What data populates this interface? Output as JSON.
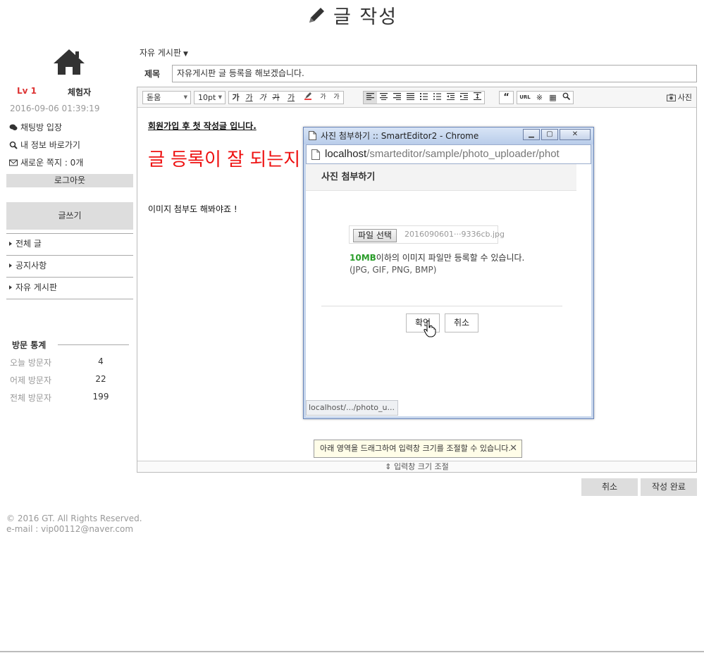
{
  "page": {
    "title": "글 작성"
  },
  "sidebar": {
    "level": "Lv 1",
    "rank": "체험자",
    "last_login": "2016-09-06 01:39:19",
    "chat_link": "채팅방 입장",
    "profile_link": "내 정보 바로가기",
    "messages_link": "새로운 쪽지 : 0개",
    "logout": "로그아웃",
    "write": "글쓰기",
    "menu": [
      {
        "label": "전체 글"
      },
      {
        "label": "공지사항"
      },
      {
        "label": "자유 게시판"
      }
    ],
    "stats": {
      "title": "방문 통계",
      "rows": [
        {
          "label": "오늘 방문자",
          "value": "4"
        },
        {
          "label": "어제 방문자",
          "value": "22"
        },
        {
          "label": "전체 방문자",
          "value": "199"
        }
      ]
    }
  },
  "form": {
    "board": "자유 게시판",
    "subject_label": "제목",
    "subject_value": "자유게시판 글 등록을 해보겠습니다."
  },
  "toolbar": {
    "font": "돋움",
    "size": "10pt",
    "photo": "사진",
    "buttons": [
      "가",
      "가",
      "가",
      "가",
      "가",
      "가",
      "가",
      "가",
      "“",
      "URL",
      "※",
      "▦",
      "🔍"
    ]
  },
  "content": {
    "line1": "회원가입 후 첫 작성글 입니다.",
    "line2": "글 등록이 잘 되는지",
    "line3": "이미지 첨부도 해봐야죠 !"
  },
  "editor": {
    "tooltip": "아래 영역을 드래그하여 입력창 크기를 조절할 수 있습니다.",
    "resize": "입력창 크기 조절"
  },
  "actions": {
    "cancel": "취소",
    "submit": "작성 완료"
  },
  "footer": {
    "copyright": "© 2016 GT. All Rights Reserved.",
    "email": "e-mail : vip00112@naver.com"
  },
  "popup": {
    "window_title": "사진 첨부하기 :: SmartEditor2 - Chrome",
    "url_host": "localhost",
    "url_path": "/smarteditor/sample/photo_uploader/phot",
    "heading": "사진 첨부하기",
    "file_button": "파일 선택",
    "file_name": "2016090601···9336cb.jpg",
    "size_limit": "10MB",
    "size_note": "이하의 이미지 파일만 등록할 수 있습니다.",
    "formats": "(JPG, GIF, PNG, BMP)",
    "ok": "확인",
    "cancel": "취소",
    "status": "localhost/.../photo_u..."
  }
}
